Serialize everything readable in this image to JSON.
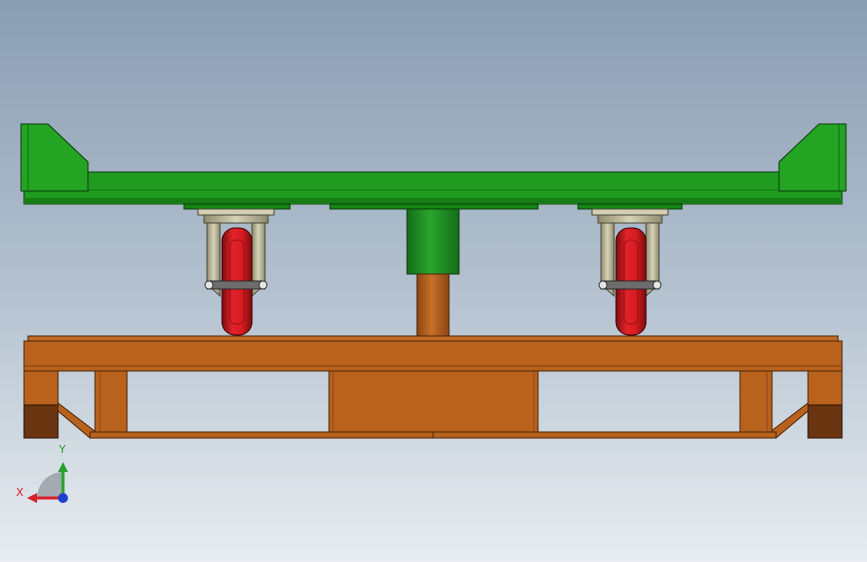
{
  "view": {
    "background_top": "#8a9db3",
    "background_bottom": "#e9edf1"
  },
  "model": {
    "parts": [
      "cart-platform",
      "caster-wheel-left",
      "caster-wheel-right",
      "lift-cylinder",
      "base-frame"
    ],
    "colors": {
      "platform": "#1f9b1f",
      "wheel": "#d4141b",
      "caster_bracket": "#c9c6a6",
      "cylinder_body": "#1f8f24",
      "cylinder_rod": "#b85e1b",
      "base_frame": "#b9621e",
      "base_feet": "#6a3410"
    }
  },
  "triad": {
    "x_label": "X",
    "y_label": "Y",
    "x_color": "#d8202a",
    "y_color": "#2aa02a",
    "z_color": "#1f3fd0"
  }
}
